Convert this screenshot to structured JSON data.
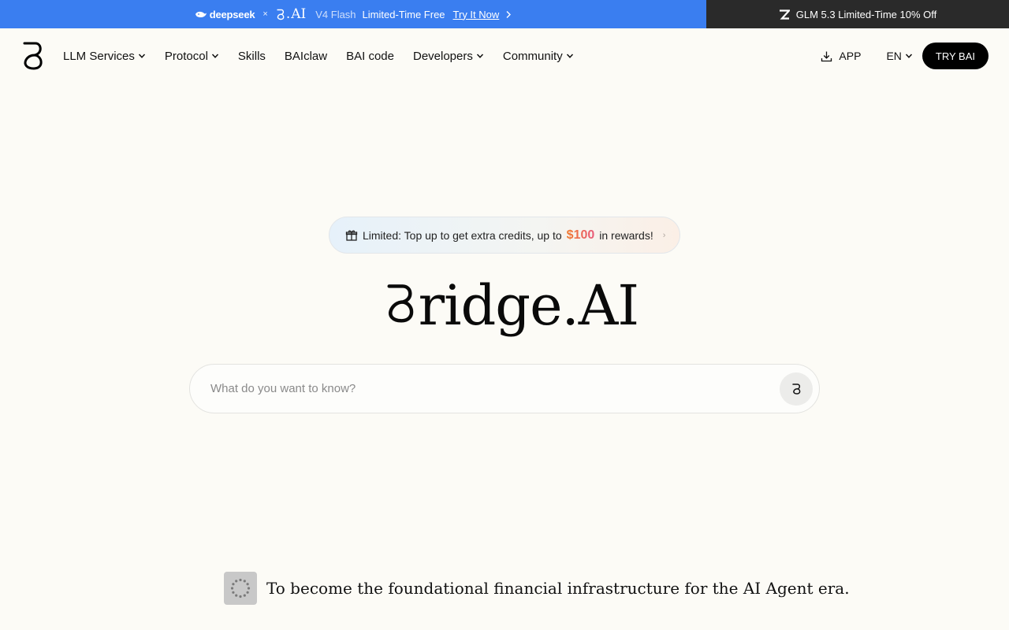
{
  "banner": {
    "deepseek_label": "deepseek",
    "times": "×",
    "bai_label": "AI",
    "flash_label": "V4 Flash",
    "promo_text": "Limited-Time Free",
    "try_link": "Try It Now",
    "right_text": "GLM 5.3 Limited-Time 10% Off",
    "left_bg": "#3a7ef0",
    "right_bg": "#2a2a2a"
  },
  "nav": {
    "items": [
      {
        "label": "LLM Services",
        "dropdown": true
      },
      {
        "label": "Protocol",
        "dropdown": true
      },
      {
        "label": "Skills",
        "dropdown": false
      },
      {
        "label": "BAIclaw",
        "dropdown": false
      },
      {
        "label": "BAI code",
        "dropdown": false
      },
      {
        "label": "Developers",
        "dropdown": true
      },
      {
        "label": "Community",
        "dropdown": true
      }
    ],
    "app_label": "APP",
    "lang_label": "EN",
    "try_label": "TRY BAI"
  },
  "hero": {
    "promo_prefix": "Limited: Top up to get extra credits, up to",
    "promo_amount": "$100",
    "promo_suffix": "in rewards!",
    "wordmark": "ridge.AI",
    "search_placeholder": "What do you want to know?",
    "mission": "To become the foundational financial infrastructure for the AI Agent era."
  },
  "icons": {
    "logo": "bridge-b-logo",
    "download": "download-icon",
    "gift": "gift-icon",
    "caret": "chevron-down-icon"
  }
}
